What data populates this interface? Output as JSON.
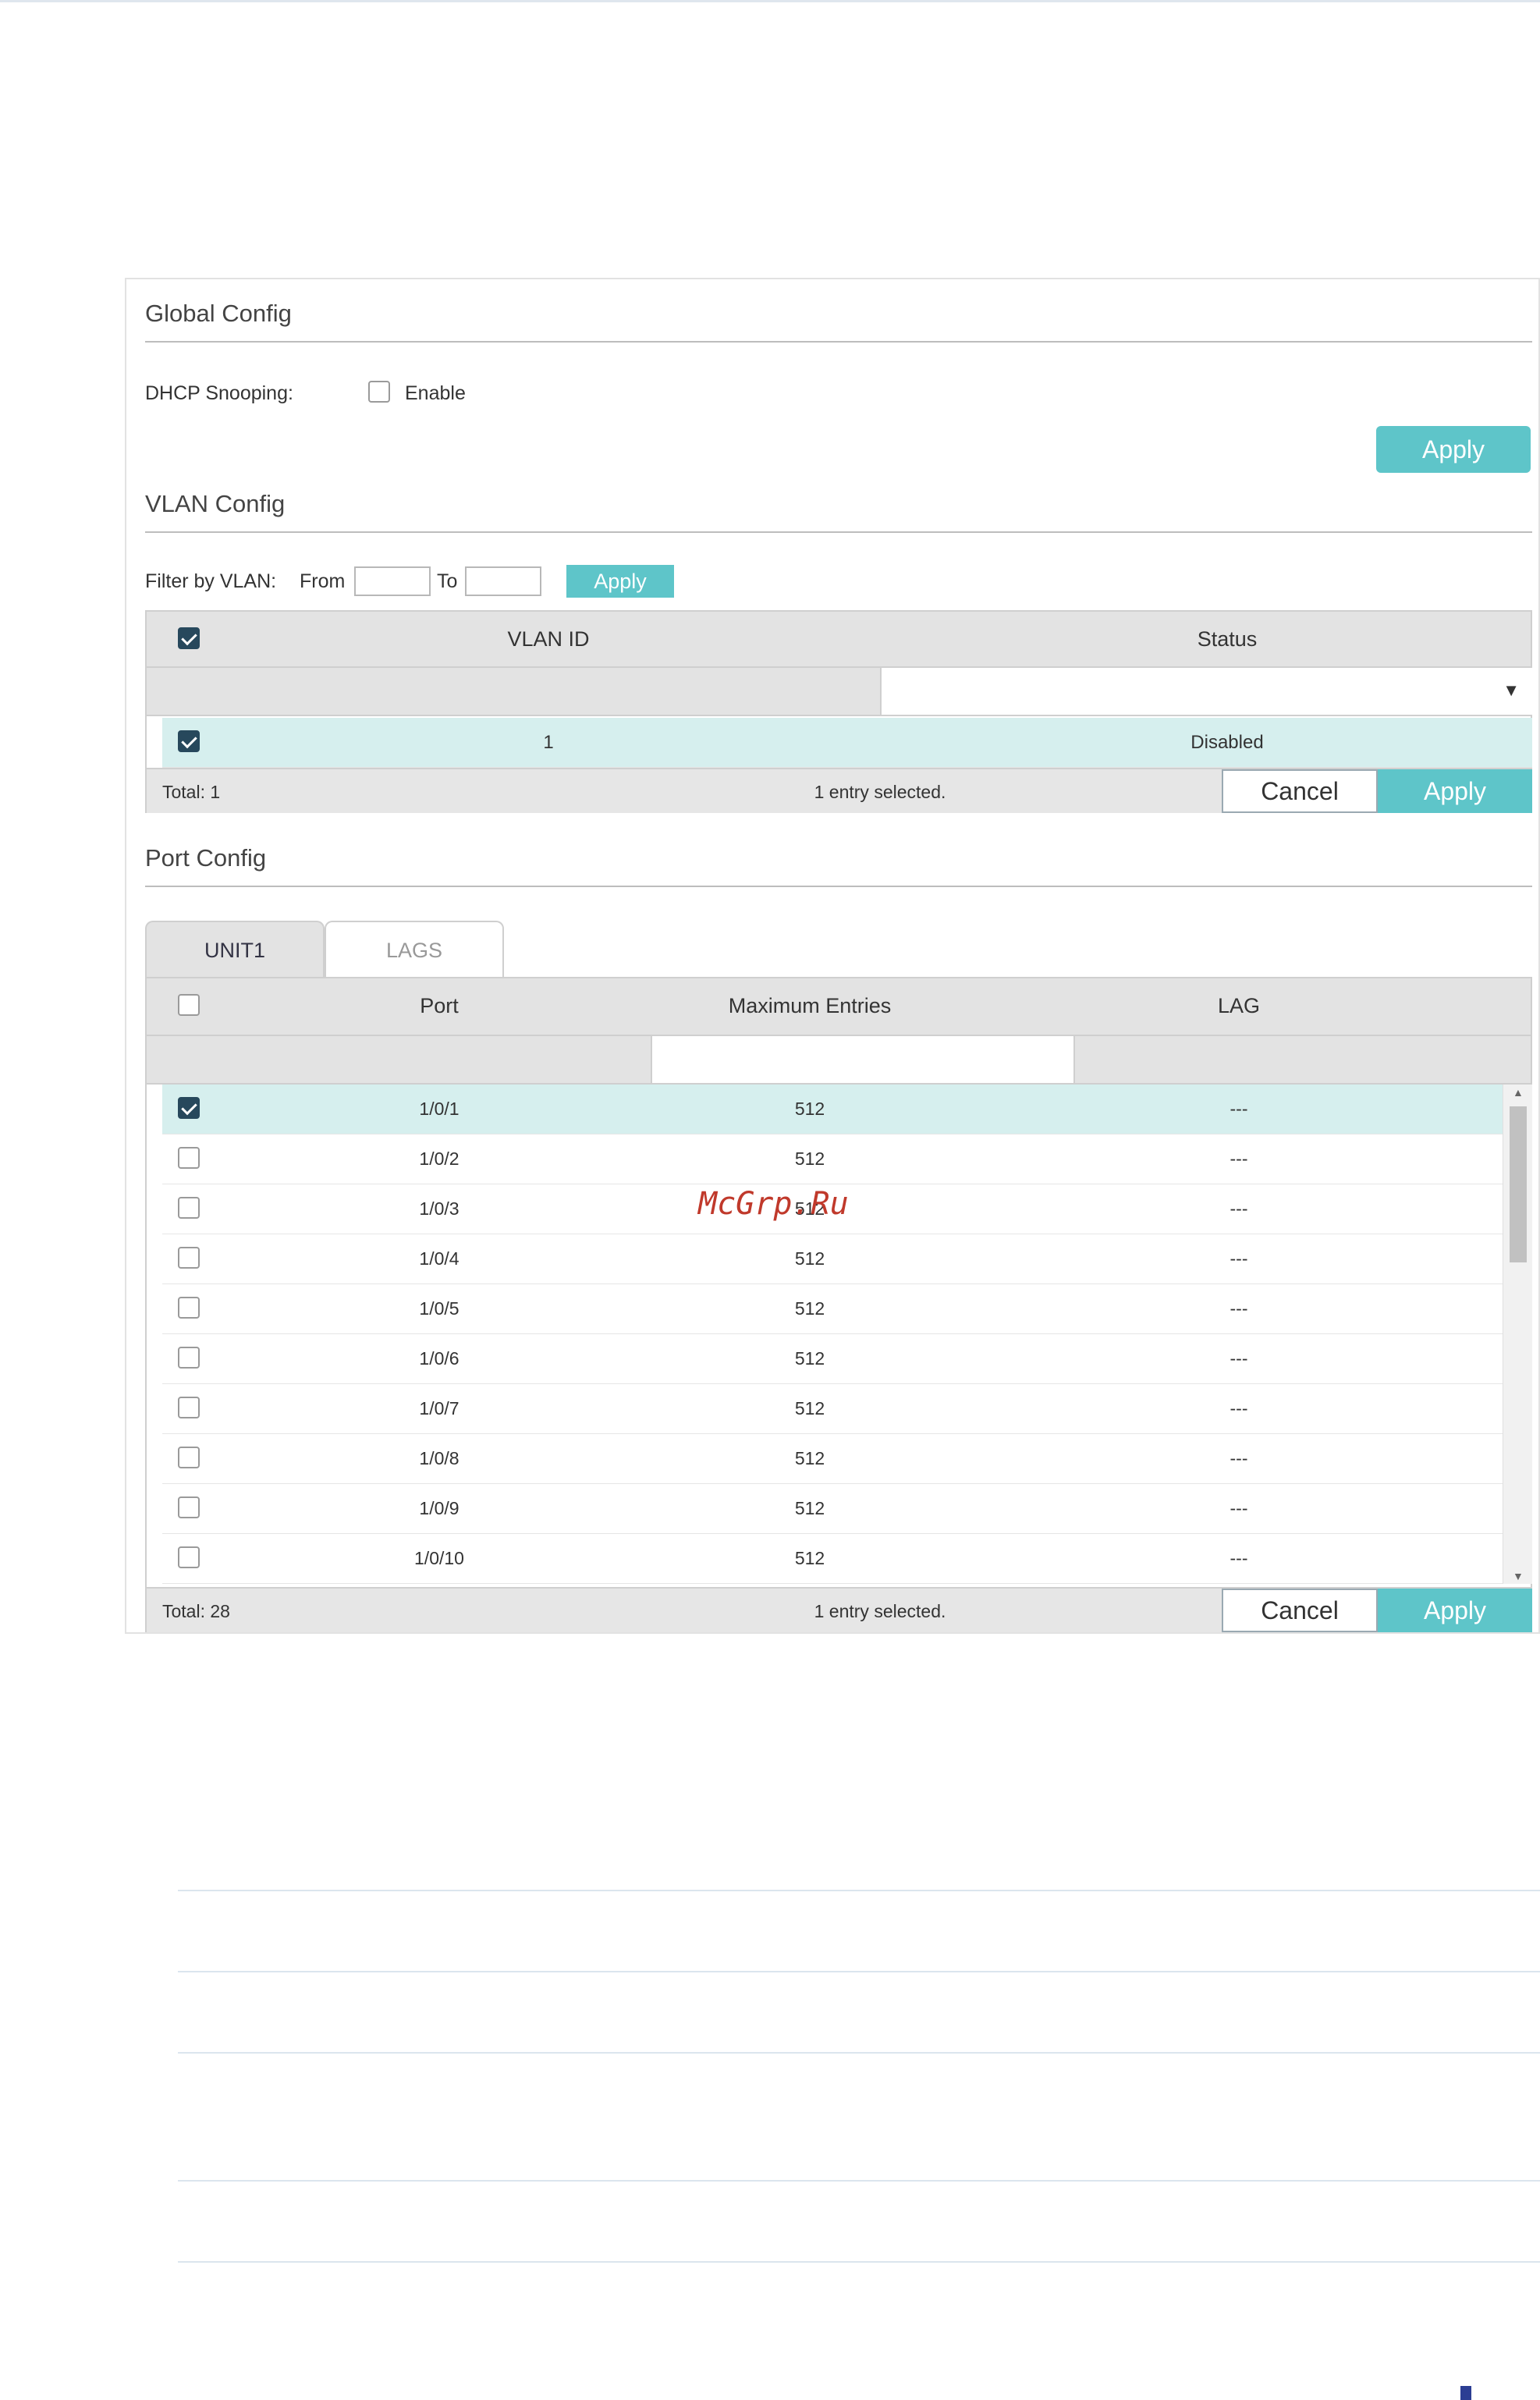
{
  "global_config": {
    "title": "Global Config",
    "dhcp_label": "DHCP Snooping:",
    "enable_label": "Enable",
    "apply_label": "Apply"
  },
  "vlan_config": {
    "title": "VLAN Config",
    "filter_label": "Filter by VLAN:",
    "from_label": "From",
    "to_label": "To",
    "filter_apply_label": "Apply",
    "columns": [
      "VLAN ID",
      "Status"
    ],
    "rows": [
      {
        "vlan_id": "1",
        "status": "Disabled",
        "checked": true
      }
    ],
    "total": "Total: 1",
    "selected": "1 entry selected.",
    "cancel_label": "Cancel",
    "apply_label": "Apply"
  },
  "port_config": {
    "title": "Port Config",
    "tabs": [
      "UNIT1",
      "LAGS"
    ],
    "active_tab": "UNIT1",
    "columns": [
      "Port",
      "Maximum Entries",
      "LAG"
    ],
    "rows": [
      {
        "port": "1/0/1",
        "max": "512",
        "lag": "---",
        "checked": true
      },
      {
        "port": "1/0/2",
        "max": "512",
        "lag": "---",
        "checked": false
      },
      {
        "port": "1/0/3",
        "max": "512",
        "lag": "---",
        "checked": false
      },
      {
        "port": "1/0/4",
        "max": "512",
        "lag": "---",
        "checked": false
      },
      {
        "port": "1/0/5",
        "max": "512",
        "lag": "---",
        "checked": false
      },
      {
        "port": "1/0/6",
        "max": "512",
        "lag": "---",
        "checked": false
      },
      {
        "port": "1/0/7",
        "max": "512",
        "lag": "---",
        "checked": false
      },
      {
        "port": "1/0/8",
        "max": "512",
        "lag": "---",
        "checked": false
      },
      {
        "port": "1/0/9",
        "max": "512",
        "lag": "---",
        "checked": false
      },
      {
        "port": "1/0/10",
        "max": "512",
        "lag": "---",
        "checked": false
      }
    ],
    "total": "Total: 28",
    "selected": "1 entry selected.",
    "cancel_label": "Cancel",
    "apply_label": "Apply"
  },
  "watermark": "McGrp.Ru",
  "colors": {
    "accent": "#5ec5c9",
    "checkbox_checked": "#27485c",
    "selected_row": "#d6efee",
    "header_bg": "#e3e3e3"
  }
}
